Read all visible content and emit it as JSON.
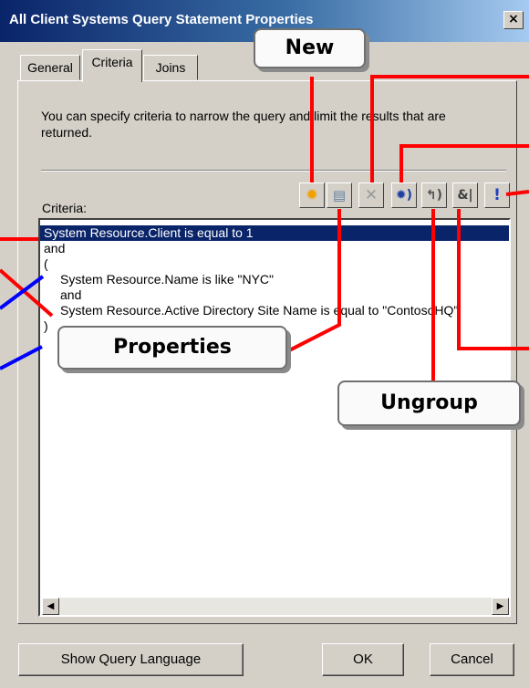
{
  "window": {
    "title": "All Client Systems Query Statement Properties",
    "close_glyph": "×"
  },
  "tabs": [
    {
      "label": "General"
    },
    {
      "label": "Criteria",
      "active": true
    },
    {
      "label": "Joins"
    }
  ],
  "description": "You can specify criteria to narrow the query and limit the results that are returned.",
  "criteria_label": "Criteria:",
  "toolbar": {
    "new_icon": "new-star-icon",
    "properties_icon": "properties-icon",
    "delete_icon": "delete-x-icon",
    "group_icon": "group-icon",
    "ungroup_icon": "ungroup-icon",
    "andor_label": "&|",
    "not_label": "!",
    "new_glyph": "✹",
    "properties_glyph": "▤",
    "delete_glyph": "✕",
    "group_glyph": "✹)",
    "ungroup_glyph": "↰)"
  },
  "criteria_lines": [
    "System Resource.Client is equal to 1",
    "and",
    "(",
    "   System Resource.Name is like \"NYC\"",
    "   and",
    "   System Resource.Active Directory Site Name is equal to \"ContosoHQ\"",
    ")"
  ],
  "scroll": {
    "left_glyph": "◀",
    "right_glyph": "▶"
  },
  "buttons": {
    "show_query_language": "Show Query Language",
    "ok": "OK",
    "cancel": "Cancel"
  },
  "callouts": {
    "new": "New",
    "properties": "Properties",
    "ungroup": "Ungroup"
  },
  "colors": {
    "title_gradient_start": "#0a246a",
    "selection": "#0a246a",
    "callout_line_red": "#ff0000",
    "callout_line_blue": "#0000ff"
  }
}
